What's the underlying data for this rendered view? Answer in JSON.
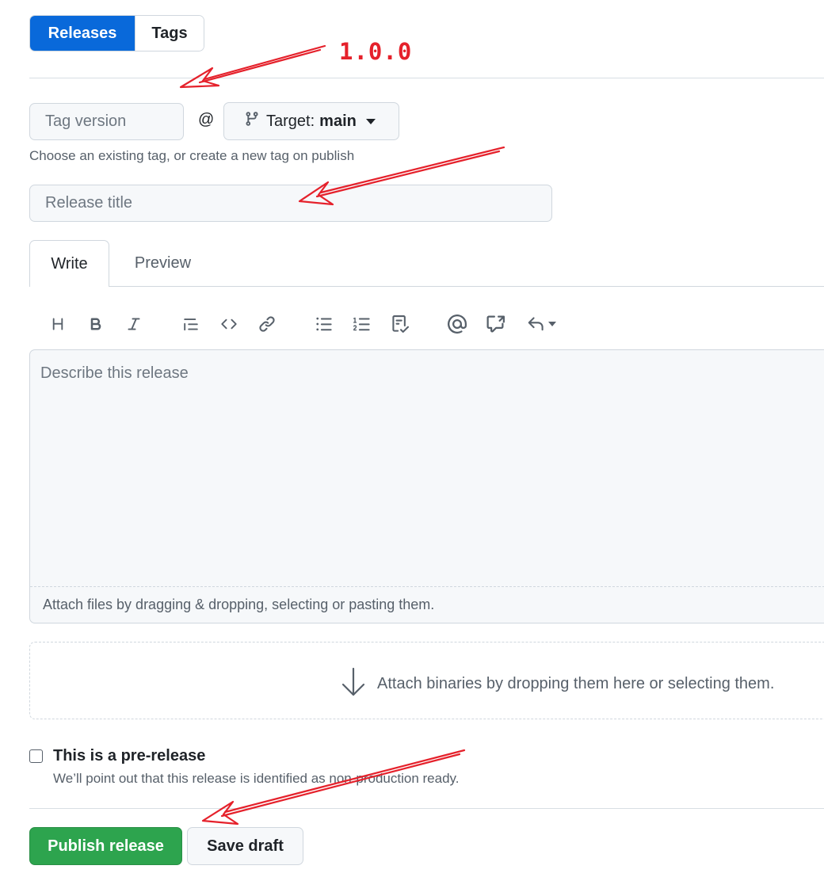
{
  "nav": {
    "releases_label": "Releases",
    "tags_label": "Tags"
  },
  "tag": {
    "placeholder": "Tag version",
    "at_symbol": "@"
  },
  "target": {
    "label": "Target:",
    "value": "main"
  },
  "tag_hint": "Choose an existing tag, or create a new tag on publish",
  "release_title": {
    "placeholder": "Release title"
  },
  "tabs": {
    "write": "Write",
    "preview": "Preview"
  },
  "toolbar": {
    "icons": [
      "heading-icon",
      "bold-icon",
      "italic-icon",
      "quote-icon",
      "code-icon",
      "link-icon",
      "bulleted-list-icon",
      "numbered-list-icon",
      "task-list-icon",
      "mention-icon",
      "cross-reference-icon",
      "saved-replies-icon"
    ]
  },
  "editor": {
    "placeholder": "Describe this release",
    "attach_text": "Attach files by dragging & dropping, selecting or pasting them."
  },
  "binaries": {
    "text": "Attach binaries by dropping them here or selecting them."
  },
  "prerelease": {
    "label": "This is a pre-release",
    "description": "We’ll point out that this release is identified as non-production ready.",
    "checked": false
  },
  "buttons": {
    "publish": "Publish release",
    "draft": "Save draft"
  },
  "annotation": {
    "text": "1.0.0",
    "color": "#e5212b"
  },
  "colors": {
    "primary": "#0969da",
    "success": "#2da44e",
    "annotation": "#e5212b"
  }
}
